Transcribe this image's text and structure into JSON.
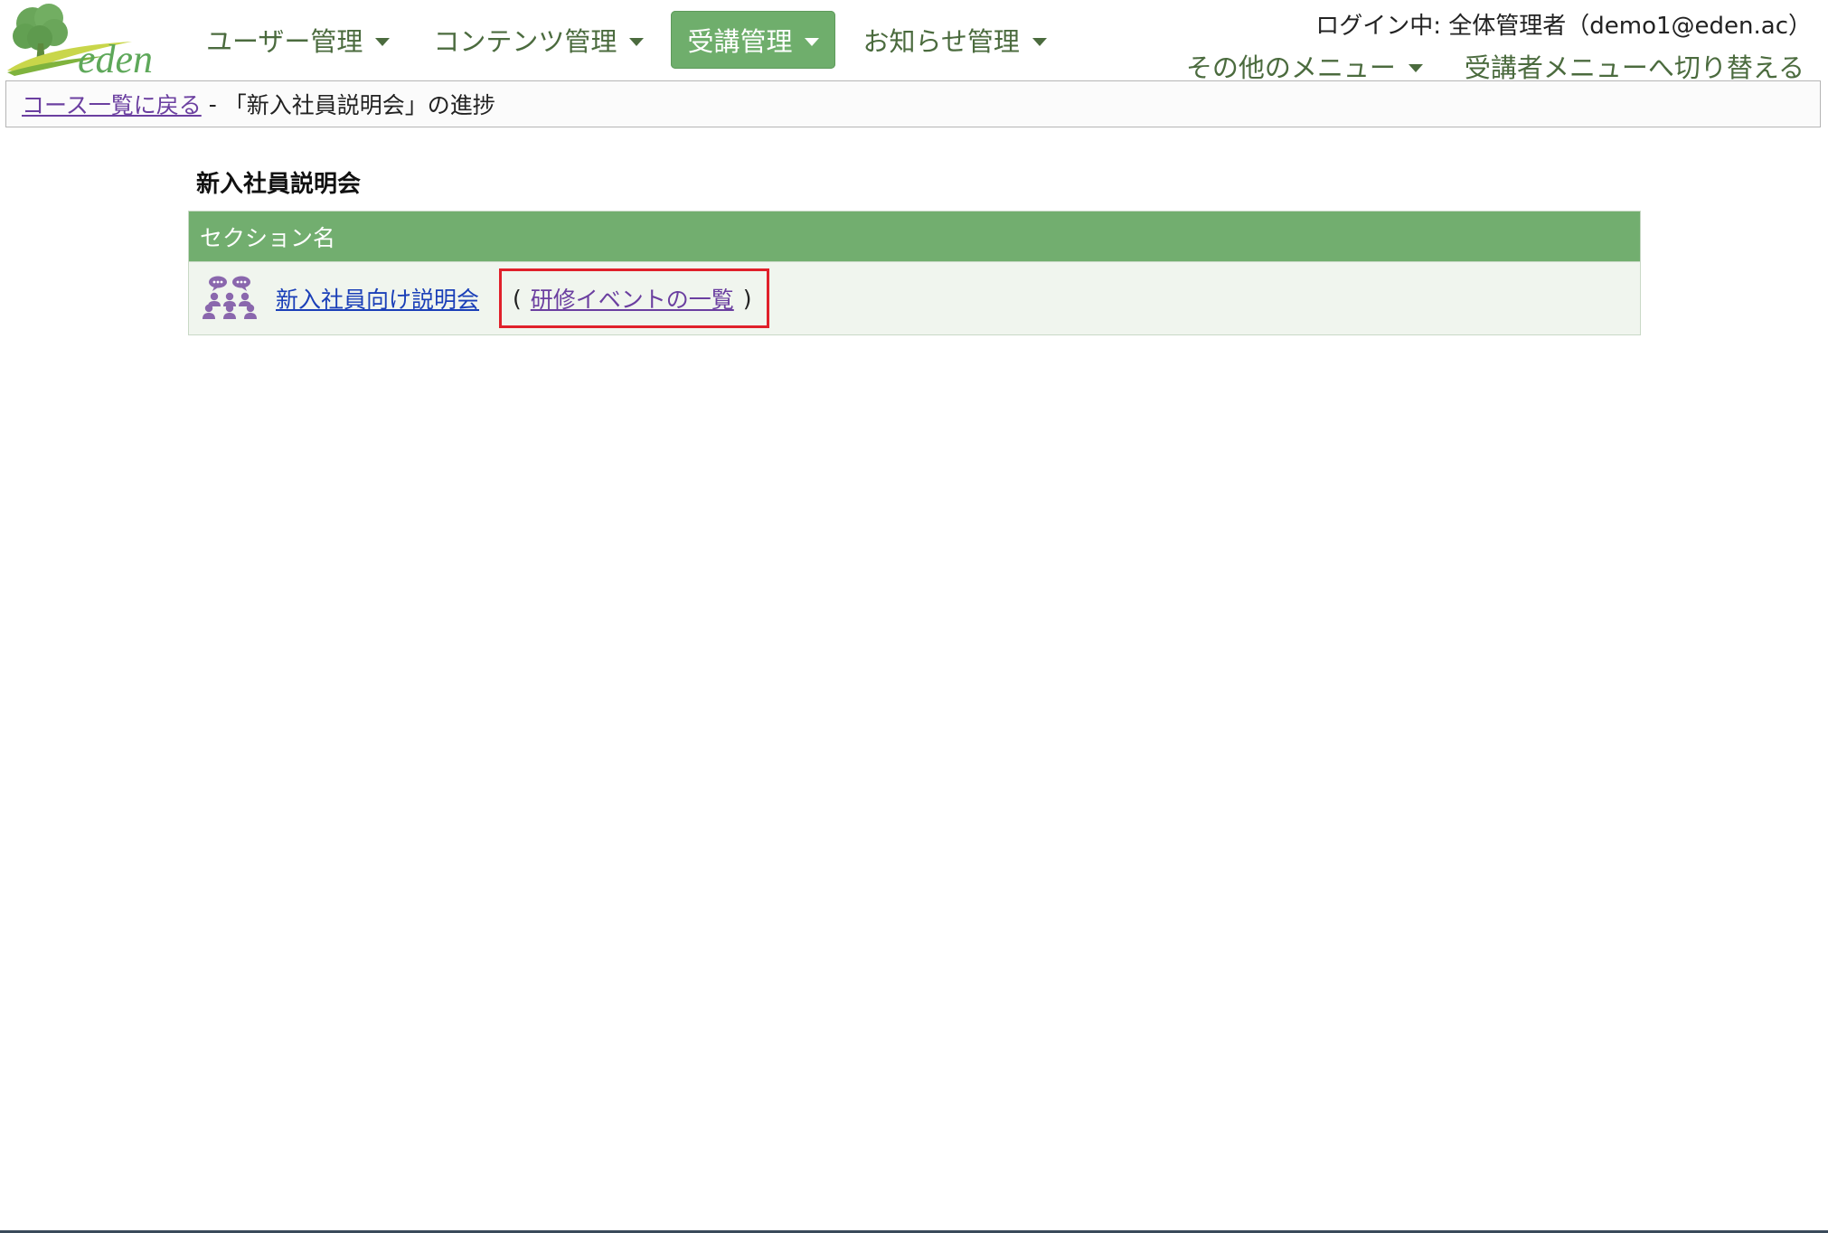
{
  "header": {
    "logo_text": "eden",
    "nav": [
      {
        "label": "ユーザー管理",
        "active": false
      },
      {
        "label": "コンテンツ管理",
        "active": false
      },
      {
        "label": "受講管理",
        "active": true
      },
      {
        "label": "お知らせ管理",
        "active": false
      }
    ],
    "login_info": "ログイン中: 全体管理者（demo1@eden.ac）",
    "other_menu_label": "その他のメニュー",
    "switch_menu_label": "受講者メニューへ切り替える"
  },
  "breadcrumb": {
    "back_link": "コース一覧に戻る",
    "separator": "-",
    "current": "「新入社員説明会」の進捗"
  },
  "main": {
    "course_title": "新入社員説明会",
    "table_header": "セクション名",
    "rows": [
      {
        "icon": "meeting-icon",
        "section_label": "新入社員向け説明会",
        "open_paren": "(",
        "events_link": "研修イベントの一覧",
        "close_paren": ")"
      }
    ]
  },
  "colors": {
    "accent_green": "#72ae6f",
    "nav_text": "#4b6b3e",
    "visited_link": "#6b3fa0",
    "link": "#1a3fb8",
    "highlight_box": "#e0202a",
    "icon_purple": "#8a67ad"
  }
}
